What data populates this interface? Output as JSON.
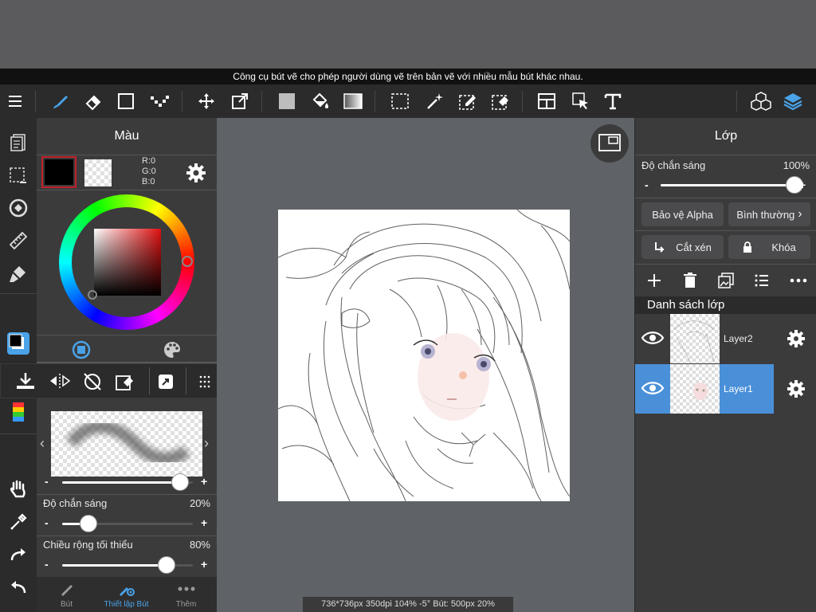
{
  "tooltip": "Công cụ bút vẽ cho phép người dùng vẽ trên bản vẽ với nhiều mẫu bút khác nhau.",
  "toolbar": {
    "tools": [
      "menu-icon",
      "brush-icon",
      "eraser-icon",
      "rectangle-icon",
      "dot-pen-icon",
      "move-icon",
      "transform-icon",
      "fill-color-icon",
      "bucket-icon",
      "gradient-icon",
      "select-rect-icon",
      "magic-wand-icon",
      "select-pen-icon",
      "select-eraser-icon",
      "layout-icon",
      "select-arrow-icon",
      "text-icon",
      "3d-icon",
      "layers-icon"
    ]
  },
  "color_panel": {
    "title": "Màu",
    "rgb": {
      "r": "R:0",
      "g": "G:0",
      "b": "B:0"
    },
    "accent": "#c0202a"
  },
  "brush_panel": {
    "sliders": [
      {
        "label": "",
        "value": ""
      },
      {
        "label": "Độ chắn sáng",
        "value": "20%"
      },
      {
        "label": "Chiều rộng tối thiểu",
        "value": "80%"
      }
    ],
    "tabs": [
      "Bút",
      "Thiết lập Bút",
      "Thêm"
    ],
    "active_tab": "Thiết lập Bút",
    "active_color": "#4aa3e8"
  },
  "status_bar": "736*736px 350dpi 104% -5° Bút: 500px 20%",
  "layers_panel": {
    "title": "Lớp",
    "opacity_label": "Độ chắn sáng",
    "opacity_value": "100%",
    "alpha_protect": "Bảo vệ Alpha",
    "blend_mode": "Bình thường",
    "clip": "Cắt xén",
    "lock": "Khóa",
    "list_title": "Danh sách lớp",
    "layers": [
      {
        "name": "Layer2",
        "selected": false
      },
      {
        "name": "Layer1",
        "selected": true
      }
    ],
    "selected_color": "#4a90d9"
  },
  "sliders_levels": {
    "main_opacity": 1.0,
    "brush_size": 0.9,
    "brush_opacity": 0.2,
    "min_width": 0.8
  }
}
